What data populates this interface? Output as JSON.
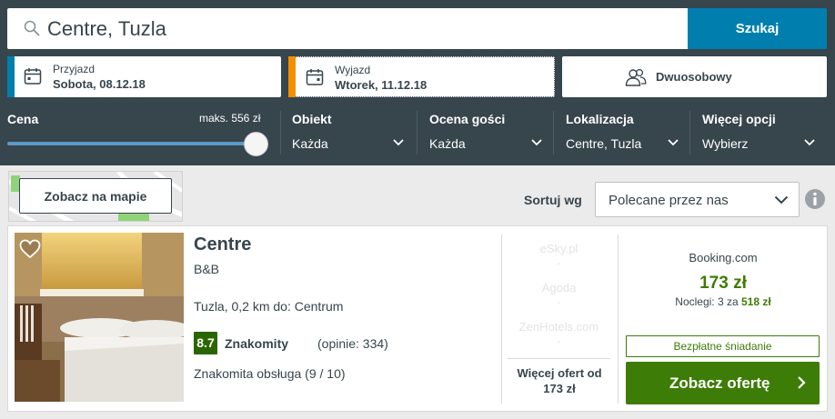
{
  "search": {
    "value": "Centre, Tuzla",
    "button_label": "Szukaj"
  },
  "dates": {
    "checkin_label": "Przyjazd",
    "checkin_value": "Sobota, 08.12.18",
    "checkout_label": "Wyjazd",
    "checkout_value": "Wtorek, 11.12.18"
  },
  "room": {
    "label": "Dwuosobowy"
  },
  "filters": {
    "price_title": "Cena",
    "price_max": "maks. 556 zł",
    "price_level_fraction": 0.99,
    "property_title": "Obiekt",
    "property_value": "Każda",
    "rating_title": "Ocena gości",
    "rating_value": "Każda",
    "location_title": "Lokalizacja",
    "location_value": "Centre, Tuzla",
    "more_title": "Więcej opcji",
    "more_value": "Wybierz"
  },
  "map": {
    "button_label": "Zobacz na mapie"
  },
  "sort": {
    "label": "Sortuj wg",
    "value": "Polecane przez nas"
  },
  "result": {
    "name": "Centre",
    "type": "B&B",
    "location": "Tuzla, 0,2 km do: Centrum",
    "rating_score": "8.7",
    "rating_text": "Znakomity",
    "rating_count": "(opinie: 334)",
    "review_highlight": "Znakomita obsługa (9 / 10)",
    "other_sites": [
      {
        "name": "eSky.pl",
        "price": "-"
      },
      {
        "name": "Agoda",
        "price": "-"
      },
      {
        "name": "ZenHotels.com",
        "price": "-"
      }
    ],
    "more_offers_line1": "Więcej ofert od",
    "more_offers_line2": "173 zł",
    "provider": "Booking.com",
    "price": "173 zł",
    "nights_prefix": "Noclegi: 3 za",
    "nights_total": "518 zł",
    "breakfast": "Bezpłatne śniadanie",
    "offer_button": "Zobacz ofertę"
  },
  "colors": {
    "header_bg": "#37454d",
    "search_button": "#007faf",
    "checkin_accent": "#007faf",
    "checkout_accent": "#f48f00",
    "offer_green": "#3d7c06",
    "rating_badge": "#2a6600"
  },
  "icons": {
    "search": "search-icon",
    "calendar_in": "calendar-icon",
    "calendar_out": "calendar-checkout-icon",
    "room": "users-icon",
    "chevron": "chevron-down-icon",
    "info": "info-icon",
    "heart": "heart-icon",
    "arrow": "chevron-right-icon"
  }
}
